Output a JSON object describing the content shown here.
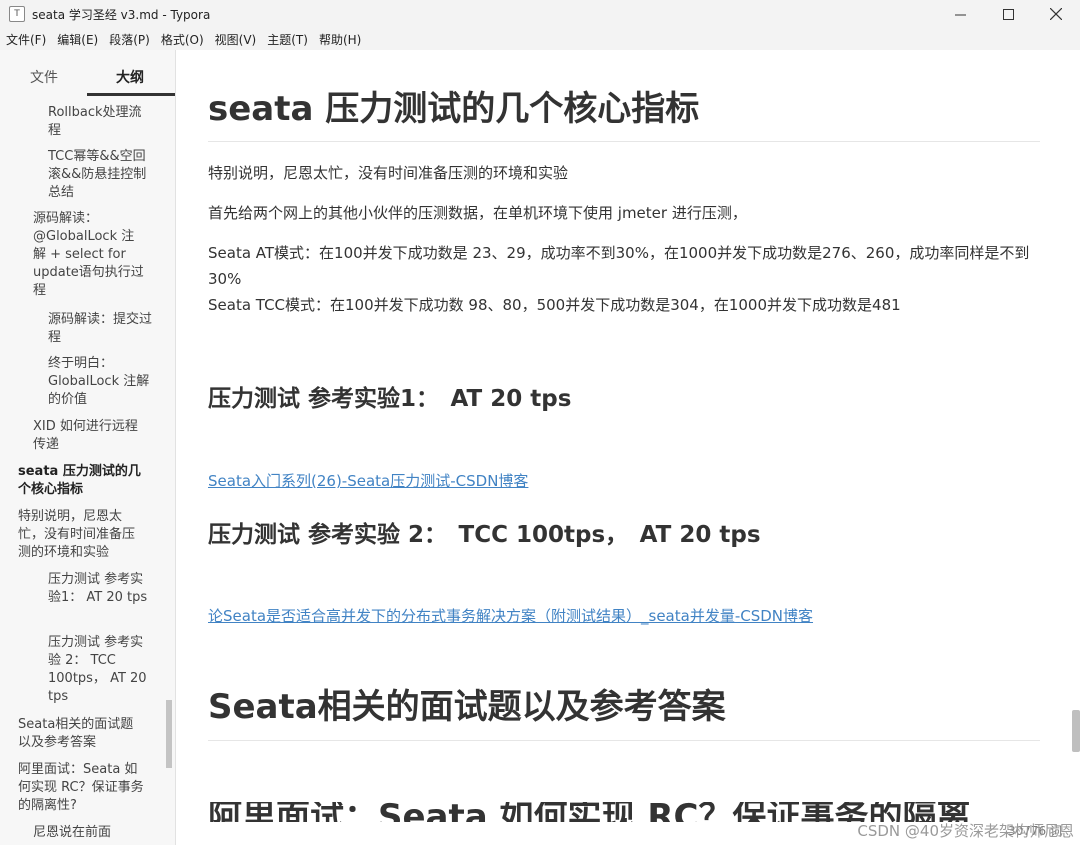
{
  "window": {
    "title": "seata 学习圣经 v3.md - Typora",
    "app_icon_glyph": "T"
  },
  "menu": [
    "文件(F)",
    "编辑(E)",
    "段落(P)",
    "格式(O)",
    "视图(V)",
    "主题(T)",
    "帮助(H)"
  ],
  "sidebar": {
    "tabs": {
      "files": "文件",
      "outline": "大纲"
    },
    "items": [
      "Rollback处理流程",
      "TCC幂等&&空回滚&&防悬挂控制总结",
      "源码解读：@GlobalLock 注解 + select for update语句执行过程",
      "源码解读：提交过程",
      "终于明白：GlobalLock 注解的价值",
      "XID 如何进行远程传递",
      "seata 压力测试的几个核心指标",
      "特别说明，尼恩太忙，没有时间准备压测的环境和实验",
      "压力测试 参考实验1： AT 20 tps",
      "压力测试 参考实验 2： TCC 100tps， AT 20 tps",
      "Seata相关的面试题以及参考答案",
      "阿里面试：Seata 如何实现 RC？保证事务的隔离性?",
      "尼恩说在前面"
    ],
    "bottom": {
      "back": "‹",
      "source": "</>"
    }
  },
  "editor": {
    "h1": "seata 压力测试的几个核心指标",
    "p1": "特别说明，尼恩太忙，没有时间准备压测的环境和实验",
    "p2": "首先给两个网上的其他小伙伴的压测数据，在单机环境下使用 jmeter 进行压测，",
    "p3a": "Seata AT模式：在100并发下成功数是 23、29，成功率不到30%，在1000并发下成功数是276、260，成功率同样是不到30%",
    "p3b": "Seata TCC模式：在100并发下成功数 98、80，500并发下成功数是304，在1000并发下成功数是481",
    "h3a": "压力测试 参考实验1：　AT 20 tps",
    "link1": "Seata入门系列(26)-Seata压力测试-CSDN博客",
    "h3b": "压力测试 参考实验 2：　TCC 100tps，　AT 20 tps",
    "link2": "论Seata是否适合高并发下的分布式事务解决方案（附测试结果）_seata并发量-CSDN博客",
    "h1b": "Seata相关的面试题以及参考答案",
    "h1c": "阿里面试：Seata 如何实现 RC？保证事务的隔离",
    "word_count": "30776 词"
  },
  "watermark": "CSDN @40岁资深老架构师尼恩"
}
